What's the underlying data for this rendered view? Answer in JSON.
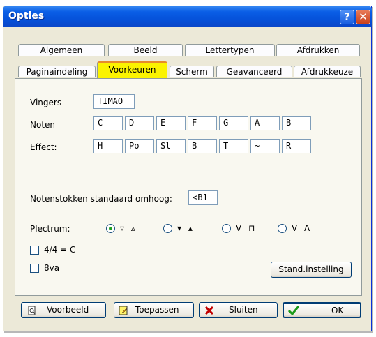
{
  "window": {
    "title": "Opties"
  },
  "titlebar": {
    "help_label": "?",
    "close_label": "✕"
  },
  "tabs_row1": [
    "Algemeen",
    "Beeld",
    "Lettertypen",
    "Afdrukken"
  ],
  "tabs_row2": [
    "Paginaindeling",
    "Voorkeuren",
    "Scherm",
    "Geavanceerd",
    "Afdrukkeuze"
  ],
  "active_tab": "Voorkeuren",
  "fields": {
    "vingers_label": "Vingers",
    "vingers_value": "TIMAO",
    "noten_label": "Noten",
    "noten_values": [
      "C",
      "D",
      "E",
      "F",
      "G",
      "A",
      "B"
    ],
    "effect_label": "Effect:",
    "effect_values": [
      "H",
      "Po",
      "Sl",
      "B",
      "T",
      "~",
      "R"
    ],
    "stokken_label": "Notenstokken standaard omhoog:",
    "stokken_value": "<B1"
  },
  "plectrum": {
    "label": "Plectrum:",
    "options": [
      "▿ ▵",
      "▾ ▴",
      "V ⊓",
      "V Λ"
    ],
    "selected_index": 0
  },
  "checkboxes": {
    "c44_label": "4/4 = C",
    "c8va_label": "8va"
  },
  "buttons": {
    "standard": "Stand.instelling",
    "preview": "Voorbeeld",
    "apply": "Toepassen",
    "close": "Sluiten",
    "ok": "OK"
  },
  "colors": {
    "titlebar": "#0a5ee6",
    "active_tab": "#fbf300",
    "dialog_bg": "#ece9d8",
    "panel_bg": "#f9f8f0"
  }
}
